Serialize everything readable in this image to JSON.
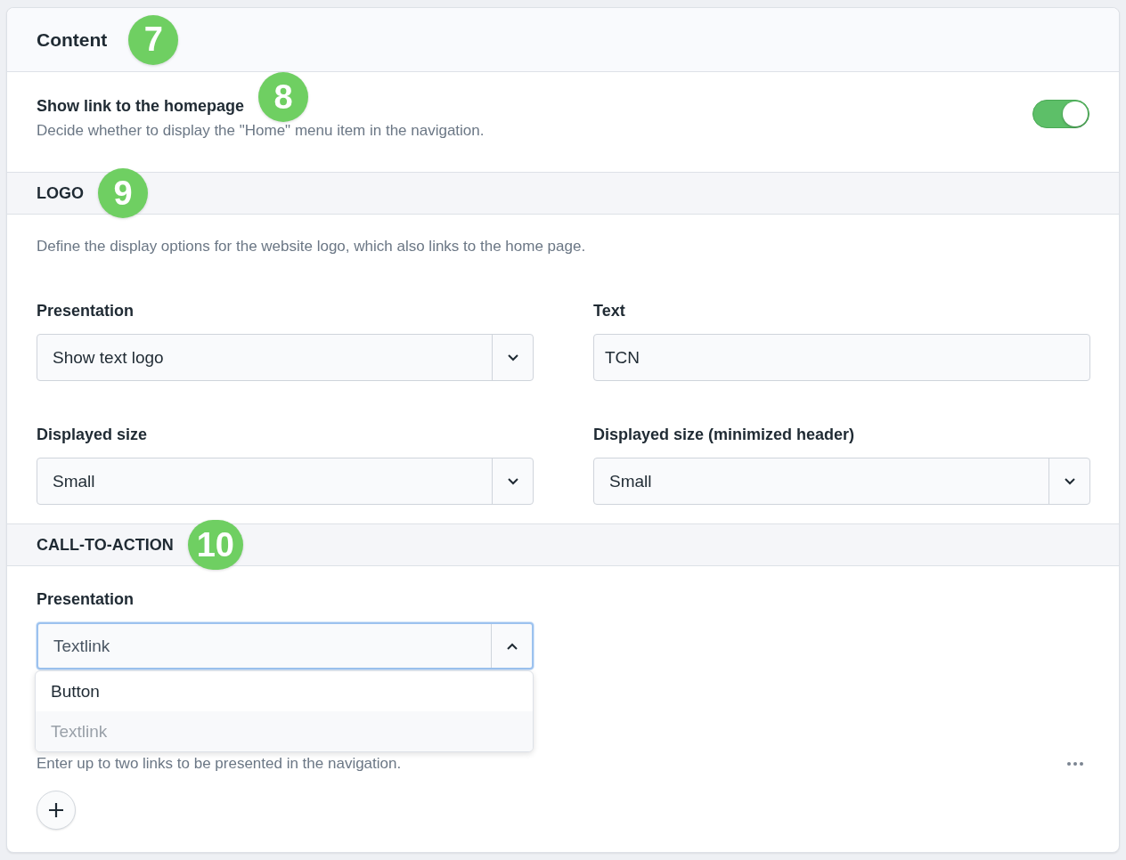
{
  "header": {
    "title": "Content",
    "marker": "7"
  },
  "homepage_setting": {
    "title": "Show link to the homepage",
    "marker": "8",
    "description": "Decide whether to display the \"Home\" menu item in the navigation.",
    "on": true
  },
  "logo": {
    "heading": "LOGO",
    "marker": "9",
    "description": "Define the display options for the website logo, which also links to the home page.",
    "fields": [
      {
        "label": "Presentation",
        "kind": "select",
        "value": "Show text logo",
        "expanded": false
      },
      {
        "label": "Text",
        "kind": "text",
        "value": "TCN"
      },
      {
        "label": "Displayed size",
        "kind": "select",
        "value": "Small",
        "expanded": false
      },
      {
        "label": "Displayed size (minimized header)",
        "kind": "select",
        "value": "Small",
        "expanded": false
      }
    ]
  },
  "call_to_action": {
    "heading": "CALL-TO-ACTION",
    "marker": "10",
    "fields": [
      {
        "label": "Presentation",
        "kind": "select",
        "value": "Textlink",
        "expanded": true,
        "options": [
          {
            "label": "Button",
            "selected": false
          },
          {
            "label": "Textlink",
            "selected": true
          }
        ]
      }
    ],
    "description": "Enter up to two links to be presented in the navigation."
  }
}
